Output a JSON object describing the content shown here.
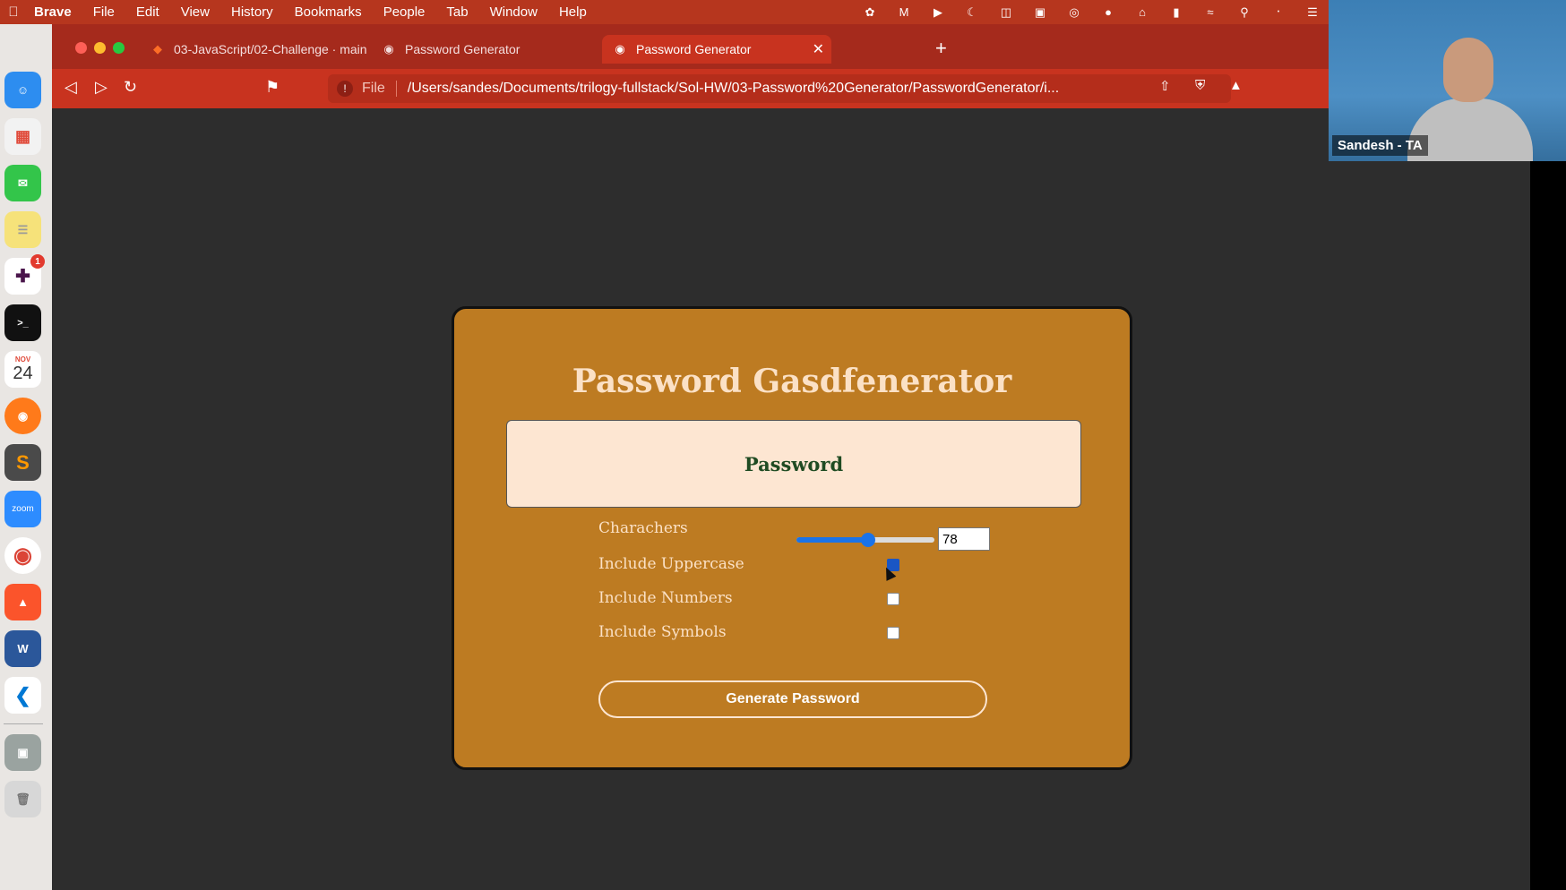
{
  "menubar": {
    "app_name": "Brave",
    "items": [
      "File",
      "Edit",
      "View",
      "History",
      "Bookmarks",
      "People",
      "Tab",
      "Window",
      "Help"
    ],
    "status_icons": [
      "airdrop-icon",
      "m-app-icon",
      "play-icon",
      "moon-icon",
      "split-icon",
      "m-icon",
      "airplay-icon",
      "record-icon",
      "network-icon",
      "battery-icon",
      "wifi-icon",
      "search-icon",
      "bluetooth-icon",
      "control-center-icon"
    ]
  },
  "browser": {
    "tabs": [
      {
        "title": "03-JavaScript/02-Challenge · main",
        "icon": "gitlab-icon",
        "active": false
      },
      {
        "title": "Password Generator",
        "icon": "globe-icon",
        "active": false
      },
      {
        "title": "Password Generator",
        "icon": "globe-icon",
        "active": true
      }
    ],
    "url_scheme": "File",
    "url": "/Users/sandes/Documents/trilogy-fullstack/Sol-HW/03-Password%20Generator/PasswordGenerator/i..."
  },
  "page": {
    "title": "Password Gasdfenerator",
    "password_placeholder": "Password",
    "characters_label": "Charachers",
    "characters_value": "78",
    "slider_fraction": 0.52,
    "options": [
      {
        "label": "Include Uppercase",
        "checked": true
      },
      {
        "label": "Include Numbers",
        "checked": false
      },
      {
        "label": "Include Symbols",
        "checked": false
      }
    ],
    "generate_label": "Generate Password"
  },
  "dock": {
    "apps": [
      "finder-icon",
      "launchpad-icon",
      "messages-icon",
      "notes-icon",
      "slack-icon",
      "terminal-icon",
      "calendar-icon",
      "firefox-icon",
      "sublime-icon",
      "zoom-icon",
      "chrome-icon",
      "brave-icon",
      "word-icon",
      "vscode-icon",
      "preview-icon",
      "trash-icon"
    ],
    "calendar_month": "NOV",
    "calendar_day": "24",
    "slack_badge": "1",
    "zoom_label": "zoom"
  },
  "webcam": {
    "name": "Sandesh - TA"
  },
  "colors": {
    "browser_chrome": "#c8331f",
    "card_bg": "#bd7b22",
    "title_text": "#fbe1c6",
    "password_box": "#fde6d2",
    "password_text": "#1f4b22",
    "slider_accent": "#1a73e8"
  }
}
